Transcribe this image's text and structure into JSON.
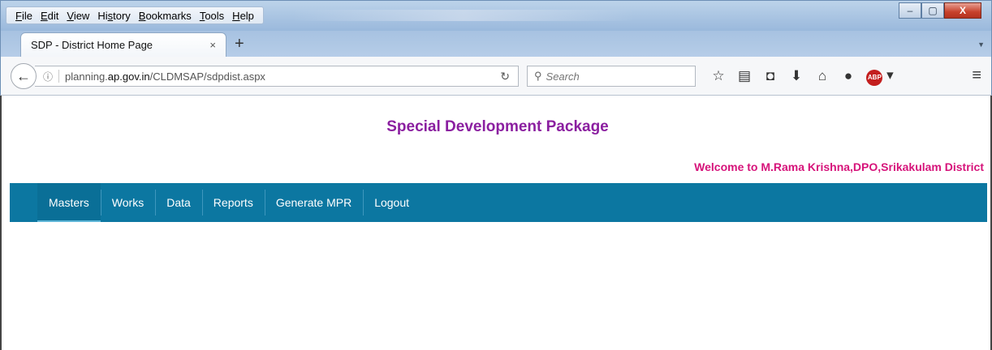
{
  "browser": {
    "menu": [
      "File",
      "Edit",
      "View",
      "History",
      "Bookmarks",
      "Tools",
      "Help"
    ],
    "menu_accesskeys": [
      "F",
      "E",
      "V",
      "s",
      "B",
      "T",
      "H"
    ],
    "tab": {
      "title": "SDP - District Home Page",
      "close": "×",
      "new_tab": "+"
    },
    "url": {
      "prefix": "planning.",
      "host": "ap.gov.in",
      "path": "/CLDMSAP/sdpdist.aspx"
    },
    "search_placeholder": "Search",
    "window_controls": {
      "minimize": "–",
      "maximize": "▢",
      "close": "X"
    },
    "toolbar_icons": [
      "star-icon",
      "reading-list-icon",
      "pocket-icon",
      "download-icon",
      "home-icon",
      "chat-icon",
      "adblock-icon",
      "menu-icon"
    ],
    "abp_label": "ABP"
  },
  "page": {
    "title": "Special Development Package",
    "welcome": "Welcome to M.Rama Krishna,DPO,Srikakulam District",
    "nav": [
      "Masters",
      "Works",
      "Data",
      "Reports",
      "Generate MPR",
      "Logout"
    ],
    "active_nav": "Masters",
    "colors": {
      "title": "#8b1fa0",
      "welcome": "#d6137a",
      "nav_background": "#0c77a1"
    }
  }
}
